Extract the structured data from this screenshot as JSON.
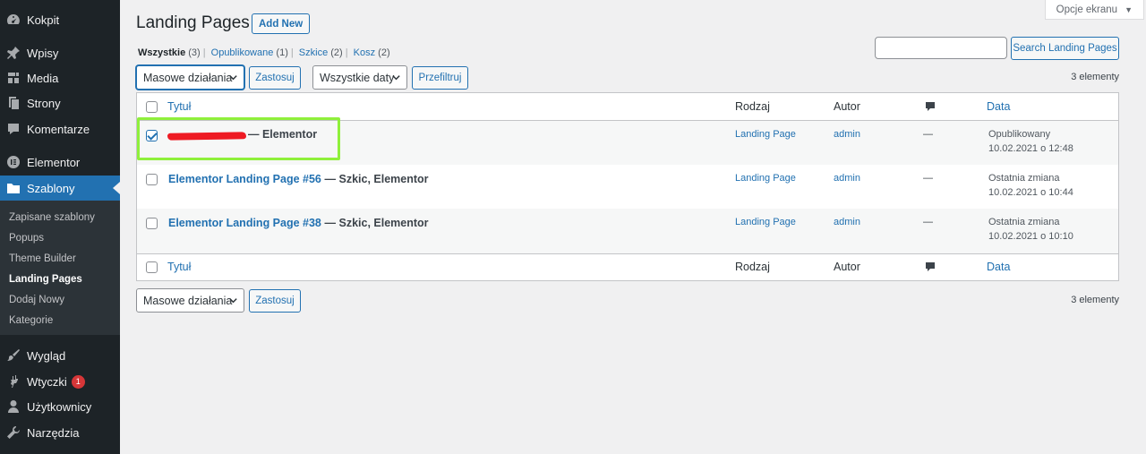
{
  "sidebar": {
    "items": [
      {
        "label": "Kokpit",
        "icon": "dashboard-icon"
      },
      {
        "label": "Wpisy",
        "icon": "pin-icon"
      },
      {
        "label": "Media",
        "icon": "media-icon"
      },
      {
        "label": "Strony",
        "icon": "page-icon"
      },
      {
        "label": "Komentarze",
        "icon": "comment-icon"
      },
      {
        "label": "Elementor",
        "icon": "elementor-icon"
      },
      {
        "label": "Szablony",
        "icon": "folder-icon"
      },
      {
        "label": "Wygląd",
        "icon": "brush-icon"
      },
      {
        "label": "Wtyczki",
        "icon": "plugin-icon",
        "badge": "1"
      },
      {
        "label": "Użytkownicy",
        "icon": "user-icon"
      },
      {
        "label": "Narzędzia",
        "icon": "wrench-icon"
      }
    ],
    "submenu": [
      "Zapisane szablony",
      "Popups",
      "Theme Builder",
      "Landing Pages",
      "Dodaj Nowy",
      "Kategorie"
    ]
  },
  "header": {
    "title": "Landing Pages",
    "add_new": "Add New",
    "screen_options": "Opcje ekranu"
  },
  "filters": {
    "all": "Wszystkie",
    "all_count": "(3)",
    "published": "Opublikowane",
    "published_count": "(1)",
    "drafts": "Szkice",
    "drafts_count": "(2)",
    "trash": "Kosz",
    "trash_count": "(2)"
  },
  "search": {
    "button": "Search Landing Pages",
    "value": ""
  },
  "toolbar": {
    "bulk_actions": "Masowe działania",
    "apply": "Zastosuj",
    "all_dates": "Wszystkie daty",
    "filter": "Przefiltruj",
    "items_count": "3 elementy"
  },
  "table": {
    "columns": {
      "title": "Tytuł",
      "type": "Rodzaj",
      "author": "Autor",
      "date": "Data"
    },
    "rows": [
      {
        "title": "",
        "suffix": "— Elementor",
        "type": "Landing Page",
        "author": "admin",
        "comments": "—",
        "status": "Opublikowany",
        "date": "10.02.2021 o 12:48",
        "checked": true
      },
      {
        "title": "Elementor Landing Page #56",
        "suffix": "— Szkic, Elementor",
        "type": "Landing Page",
        "author": "admin",
        "comments": "—",
        "status": "Ostatnia zmiana",
        "date": "10.02.2021 o 10:44",
        "checked": false
      },
      {
        "title": "Elementor Landing Page #38",
        "suffix": "— Szkic, Elementor",
        "type": "Landing Page",
        "author": "admin",
        "comments": "—",
        "status": "Ostatnia zmiana",
        "date": "10.02.2021 o 10:10",
        "checked": false
      }
    ]
  },
  "colors": {
    "accent": "#2271b1",
    "sidebar_bg": "#1d2327",
    "highlight": "#8ff03b",
    "redaction": "#ee1b24"
  }
}
